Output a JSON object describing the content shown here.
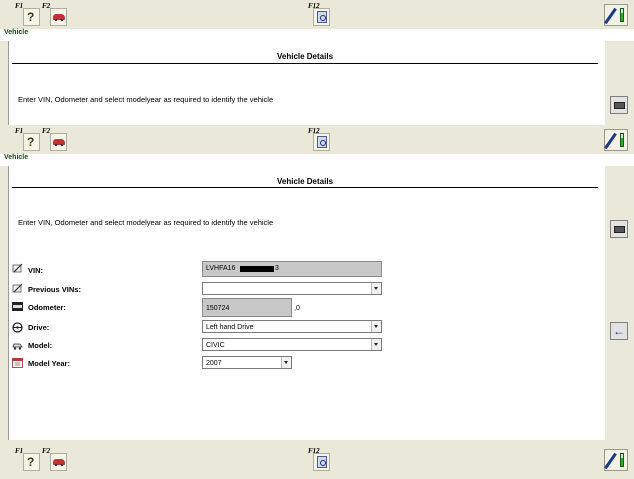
{
  "toolbar": {
    "f1_label": "F1",
    "f2_label": "F2",
    "f12_label": "F12"
  },
  "section_label": "Vehicle",
  "details": {
    "title": "Vehicle Details",
    "instruction": "Enter VIN, Odometer and select modelyear as required to identify the vehicle"
  },
  "form": {
    "vin": {
      "label": "VIN:",
      "value": "LVHFA16",
      "value_suffix": "3"
    },
    "previous_vins": {
      "label": "Previous VINs:",
      "value": ""
    },
    "odometer": {
      "label": "Odometer:",
      "value": "150724",
      "suffix": ",0"
    },
    "drive": {
      "label": "Drive:",
      "value": "Left hand Drive"
    },
    "model": {
      "label": "Model:",
      "value": "CIVIC"
    },
    "model_year": {
      "label": "Model Year:",
      "value": "2007"
    }
  },
  "icons": {
    "help": "help-icon",
    "vehicle": "car-icon",
    "f12": "search-document-icon",
    "pen": "pen-tool-icon",
    "keyboard": "keyboard-icon",
    "back": "back-arrow-icon"
  }
}
